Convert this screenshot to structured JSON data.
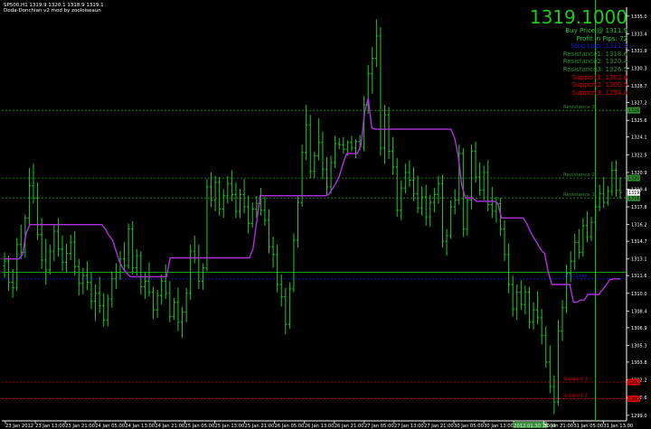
{
  "header": {
    "symbol_line": "SP500,H1  1319.9 1320.1 1318.9 1319.1",
    "indicator_name": "Doda-Donchian v2 mod by zooloiseaun"
  },
  "info_panel": {
    "price": "1319.1000",
    "rows": [
      {
        "text": "Buy Price @  1311.9",
        "color": "#2fc82f"
      },
      {
        "text": "Profit in Pips: 72",
        "color": "#2fc82f"
      },
      {
        "text": "Stop Loss: 1311.3",
        "color": "#1a1ad8"
      },
      {
        "text": "Resistance1: 1318.6",
        "color": "#2f8f2f"
      },
      {
        "text": "Resistance2: 1320.4",
        "color": "#2f8f2f"
      },
      {
        "text": "Resistance3: 1326.5",
        "color": "#2f8f2f"
      },
      {
        "text": "Support1: 1302.0",
        "color": "#e00000"
      },
      {
        "text": "Support2: 1300.5",
        "color": "#e00000"
      },
      {
        "text": "Support3: 1294.0",
        "color": "#e00000"
      }
    ]
  },
  "line_labels": {
    "resistance3": "Resistance 3",
    "resistance2": "Resistance 2",
    "resistance1": "Resistance 1",
    "stoploss": "Stop Loss",
    "support1": "Support 1",
    "support2": "Support 2"
  },
  "colors": {
    "background": "#000000",
    "bars": "#22c81e",
    "donchian": "#b030e0",
    "resistance": "#2f8f2f",
    "stop": "#1a1ad8",
    "support": "#e00000",
    "buy": "#22c81e",
    "axis": "#ffffff"
  },
  "chart_data": {
    "type": "ohlc",
    "symbol": "SP500",
    "timeframe": "H1",
    "ylim": [
      1298.5,
      1335.8
    ],
    "y_ticks": [
      1299.0,
      1300.6,
      1302.2,
      1303.8,
      1305.3,
      1306.9,
      1308.4,
      1310.0,
      1311.6,
      1313.1,
      1314.7,
      1316.2,
      1317.8,
      1319.4,
      1320.9,
      1322.5,
      1324.1,
      1325.6,
      1327.2,
      1328.7,
      1330.3,
      1331.9,
      1333.4,
      1335.0
    ],
    "x_ticks": [
      "23 Jan 2012",
      "23 Jan 13:00",
      "23 Jan 21:00",
      "24 Jan 05:00",
      "24 Jan 13:00",
      "24 Jan 21:00",
      "25 Jan 05:00",
      "25 Jan 13:00",
      "25 Jan 21:00",
      "26 Jan 05:00",
      "26 Jan 13:00",
      "26 Jan 21:00",
      "27 Jan 05:00",
      "27 Jan 13:00",
      "27 Jan 21:00",
      "30 Jan 05:00",
      "30 Jan 13:00",
      "2012.01.30 18:00",
      "30 Jan 21:00",
      "31 Jan 05:00",
      "31 Jan 13:00"
    ],
    "current_time_label": "2012.01.30 18:00",
    "levels": {
      "resistance3": 1326.5,
      "resistance2": 1320.4,
      "resistance1": 1318.6,
      "buy": 1311.9,
      "stop_loss": 1311.3,
      "support1": 1302.0,
      "support2": 1300.5,
      "current_price": 1319.1
    },
    "level_tags": {
      "resistance3": "1326.5",
      "resistance2": "1320.4",
      "resistance1": "1318.6",
      "support1": "1302.0",
      "support2": "1300.5",
      "current_price": "1319.1"
    },
    "ohlc": [
      [
        1312.5,
        1313.7,
        1311.4,
        1312.9
      ],
      [
        1312.9,
        1313.4,
        1310.2,
        1311.0
      ],
      [
        1311.0,
        1312.2,
        1309.6,
        1310.5
      ],
      [
        1310.5,
        1315.0,
        1310.2,
        1314.4
      ],
      [
        1314.4,
        1316.2,
        1313.1,
        1313.7
      ],
      [
        1313.7,
        1317.1,
        1313.2,
        1316.8
      ],
      [
        1316.8,
        1321.3,
        1316.0,
        1319.7
      ],
      [
        1319.7,
        1321.7,
        1318.1,
        1318.6
      ],
      [
        1318.6,
        1320.0,
        1314.8,
        1315.3
      ],
      [
        1315.3,
        1316.8,
        1312.2,
        1313.0
      ],
      [
        1313.0,
        1314.9,
        1310.8,
        1312.1
      ],
      [
        1312.1,
        1314.4,
        1311.7,
        1313.8
      ],
      [
        1313.8,
        1316.2,
        1312.9,
        1315.6
      ],
      [
        1315.6,
        1316.8,
        1313.3,
        1314.0
      ],
      [
        1314.0,
        1315.2,
        1312.0,
        1312.8
      ],
      [
        1312.8,
        1314.5,
        1311.9,
        1313.6
      ],
      [
        1313.6,
        1315.3,
        1313.0,
        1314.6
      ],
      [
        1314.6,
        1315.6,
        1311.6,
        1312.4
      ],
      [
        1312.4,
        1313.1,
        1309.8,
        1310.9
      ],
      [
        1310.9,
        1312.3,
        1309.9,
        1311.6
      ],
      [
        1311.6,
        1312.9,
        1310.3,
        1311.0
      ],
      [
        1311.0,
        1311.9,
        1308.6,
        1309.3
      ],
      [
        1309.3,
        1310.8,
        1307.5,
        1310.0
      ],
      [
        1310.0,
        1311.5,
        1308.2,
        1308.9
      ],
      [
        1308.9,
        1310.0,
        1307.0,
        1307.6
      ],
      [
        1307.6,
        1309.9,
        1307.0,
        1309.5
      ],
      [
        1309.5,
        1312.0,
        1308.7,
        1311.3
      ],
      [
        1311.3,
        1312.7,
        1310.4,
        1311.9
      ],
      [
        1311.9,
        1313.8,
        1311.2,
        1313.1
      ],
      [
        1313.1,
        1314.6,
        1312.0,
        1312.5
      ],
      [
        1312.5,
        1316.3,
        1312.2,
        1315.8
      ],
      [
        1315.8,
        1316.5,
        1311.7,
        1312.3
      ],
      [
        1312.3,
        1314.0,
        1311.6,
        1313.4
      ],
      [
        1313.4,
        1313.8,
        1309.9,
        1310.6
      ],
      [
        1310.6,
        1311.9,
        1309.5,
        1311.1
      ],
      [
        1311.1,
        1312.8,
        1309.7,
        1310.1
      ],
      [
        1310.1,
        1310.6,
        1307.7,
        1308.5
      ],
      [
        1308.5,
        1310.3,
        1307.8,
        1309.8
      ],
      [
        1309.8,
        1311.7,
        1309.0,
        1311.1
      ],
      [
        1311.1,
        1312.6,
        1309.5,
        1310.0
      ],
      [
        1310.0,
        1311.1,
        1307.4,
        1307.9
      ],
      [
        1307.9,
        1309.6,
        1307.6,
        1309.2
      ],
      [
        1309.2,
        1310.5,
        1306.6,
        1307.4
      ],
      [
        1307.4,
        1308.8,
        1306.0,
        1308.3
      ],
      [
        1308.3,
        1310.5,
        1307.4,
        1310.0
      ],
      [
        1310.0,
        1314.4,
        1309.4,
        1313.8
      ],
      [
        1313.8,
        1315.2,
        1312.7,
        1313.2
      ],
      [
        1313.2,
        1314.4,
        1310.4,
        1311.1
      ],
      [
        1311.1,
        1312.7,
        1310.3,
        1312.3
      ],
      [
        1312.3,
        1320.3,
        1312.0,
        1319.6
      ],
      [
        1319.6,
        1320.9,
        1317.8,
        1318.4
      ],
      [
        1318.4,
        1320.6,
        1317.4,
        1320.0
      ],
      [
        1320.0,
        1320.5,
        1317.0,
        1317.6
      ],
      [
        1317.6,
        1319.4,
        1316.8,
        1318.8
      ],
      [
        1318.8,
        1320.6,
        1318.1,
        1319.9
      ],
      [
        1319.9,
        1321.1,
        1318.3,
        1318.9
      ],
      [
        1318.9,
        1320.0,
        1316.8,
        1317.4
      ],
      [
        1317.4,
        1319.4,
        1316.8,
        1318.9
      ],
      [
        1318.9,
        1320.3,
        1317.2,
        1317.8
      ],
      [
        1317.8,
        1318.8,
        1315.4,
        1316.3
      ],
      [
        1316.3,
        1318.2,
        1315.9,
        1317.6
      ],
      [
        1317.6,
        1318.8,
        1316.8,
        1318.1
      ],
      [
        1318.1,
        1319.5,
        1317.0,
        1317.5
      ],
      [
        1317.5,
        1318.7,
        1316.1,
        1316.6
      ],
      [
        1316.6,
        1317.6,
        1313.6,
        1314.2
      ],
      [
        1314.2,
        1315.1,
        1312.3,
        1313.5
      ],
      [
        1313.5,
        1314.4,
        1310.1,
        1310.8
      ],
      [
        1310.8,
        1311.7,
        1308.8,
        1309.7
      ],
      [
        1309.7,
        1310.5,
        1306.3,
        1307.2
      ],
      [
        1307.2,
        1311.0,
        1306.8,
        1310.4
      ],
      [
        1310.4,
        1315.4,
        1310.1,
        1314.8
      ],
      [
        1314.8,
        1318.8,
        1314.1,
        1318.2
      ],
      [
        1318.2,
        1323.4,
        1317.8,
        1322.7
      ],
      [
        1322.7,
        1327.0,
        1322.0,
        1325.2
      ],
      [
        1325.2,
        1326.1,
        1320.4,
        1321.0
      ],
      [
        1321.0,
        1322.8,
        1320.4,
        1322.4
      ],
      [
        1322.4,
        1325.8,
        1322.0,
        1323.6
      ],
      [
        1323.6,
        1324.6,
        1320.3,
        1321.2
      ],
      [
        1321.2,
        1322.3,
        1318.8,
        1319.6
      ],
      [
        1319.6,
        1322.4,
        1319.0,
        1321.8
      ],
      [
        1321.8,
        1324.2,
        1321.3,
        1323.5
      ],
      [
        1323.5,
        1324.0,
        1323.0,
        1323.4
      ],
      [
        1323.4,
        1324.1,
        1322.6,
        1323.0
      ],
      [
        1323.0,
        1323.8,
        1322.4,
        1323.6
      ],
      [
        1323.6,
        1324.2,
        1322.8,
        1323.1
      ],
      [
        1323.1,
        1323.9,
        1322.2,
        1323.7
      ],
      [
        1323.7,
        1324.3,
        1322.9,
        1323.2
      ],
      [
        1323.2,
        1327.8,
        1322.8,
        1327.0
      ],
      [
        1327.0,
        1330.6,
        1326.2,
        1329.8
      ],
      [
        1329.8,
        1332.2,
        1328.0,
        1331.2
      ],
      [
        1331.2,
        1334.7,
        1330.4,
        1333.2
      ],
      [
        1333.2,
        1334.0,
        1322.4,
        1323.1
      ],
      [
        1323.1,
        1327.0,
        1321.7,
        1326.1
      ],
      [
        1326.1,
        1326.8,
        1322.1,
        1322.8
      ],
      [
        1322.8,
        1324.1,
        1320.7,
        1321.4
      ],
      [
        1321.4,
        1322.2,
        1316.9,
        1317.5
      ],
      [
        1317.5,
        1320.2,
        1316.6,
        1319.5
      ],
      [
        1319.5,
        1321.7,
        1319.0,
        1320.9
      ],
      [
        1320.9,
        1322.0,
        1319.6,
        1320.2
      ],
      [
        1320.2,
        1321.4,
        1318.3,
        1319.0
      ],
      [
        1319.0,
        1320.6,
        1317.2,
        1317.7
      ],
      [
        1317.7,
        1319.6,
        1317.0,
        1318.7
      ],
      [
        1318.7,
        1319.8,
        1316.1,
        1316.9
      ],
      [
        1316.9,
        1318.9,
        1316.0,
        1318.2
      ],
      [
        1318.2,
        1319.5,
        1317.3,
        1318.9
      ],
      [
        1318.9,
        1320.6,
        1318.1,
        1319.9
      ],
      [
        1319.9,
        1320.7,
        1314.1,
        1314.7
      ],
      [
        1314.7,
        1315.8,
        1313.4,
        1315.2
      ],
      [
        1315.2,
        1318.4,
        1314.9,
        1317.8
      ],
      [
        1317.8,
        1319.4,
        1317.1,
        1318.4
      ],
      [
        1318.4,
        1323.4,
        1318.0,
        1322.6
      ],
      [
        1322.6,
        1323.1,
        1315.1,
        1315.8
      ],
      [
        1315.8,
        1318.9,
        1315.2,
        1318.4
      ],
      [
        1318.4,
        1323.4,
        1317.6,
        1322.8
      ],
      [
        1322.8,
        1323.7,
        1320.0,
        1320.5
      ],
      [
        1320.5,
        1321.8,
        1318.8,
        1319.3
      ],
      [
        1319.3,
        1321.5,
        1318.4,
        1320.9
      ],
      [
        1320.9,
        1322.0,
        1317.4,
        1318.0
      ],
      [
        1318.0,
        1319.6,
        1316.8,
        1317.4
      ],
      [
        1317.4,
        1318.7,
        1316.4,
        1318.1
      ],
      [
        1318.1,
        1318.6,
        1315.2,
        1315.8
      ],
      [
        1315.8,
        1316.6,
        1312.9,
        1313.5
      ],
      [
        1313.5,
        1314.5,
        1310.0,
        1310.8
      ],
      [
        1310.8,
        1311.6,
        1307.9,
        1308.6
      ],
      [
        1308.6,
        1310.8,
        1307.6,
        1310.1
      ],
      [
        1310.1,
        1311.2,
        1308.5,
        1309.0
      ],
      [
        1309.0,
        1310.7,
        1308.1,
        1310.1
      ],
      [
        1310.1,
        1310.6,
        1306.8,
        1307.4
      ],
      [
        1307.4,
        1309.2,
        1306.7,
        1308.5
      ],
      [
        1308.5,
        1310.2,
        1307.2,
        1307.8
      ],
      [
        1307.8,
        1308.6,
        1305.4,
        1306.2
      ],
      [
        1306.2,
        1307.0,
        1303.3,
        1303.8
      ],
      [
        1303.8,
        1305.3,
        1301.0,
        1301.6
      ],
      [
        1301.6,
        1302.6,
        1299.1,
        1300.2
      ],
      [
        1300.2,
        1307.6,
        1299.9,
        1306.6
      ],
      [
        1306.6,
        1309.4,
        1305.7,
        1308.7
      ],
      [
        1308.7,
        1312.6,
        1308.2,
        1311.8
      ],
      [
        1311.8,
        1313.8,
        1311.0,
        1312.9
      ],
      [
        1312.9,
        1315.4,
        1312.1,
        1314.6
      ],
      [
        1314.6,
        1315.8,
        1313.1,
        1313.7
      ],
      [
        1313.7,
        1316.8,
        1313.3,
        1316.1
      ],
      [
        1316.1,
        1317.4,
        1314.6,
        1315.1
      ],
      [
        1315.1,
        1316.9,
        1314.7,
        1316.4
      ],
      [
        1316.4,
        1318.4,
        1315.9,
        1317.8
      ],
      [
        1317.8,
        1319.8,
        1317.4,
        1319.0
      ],
      [
        1319.0,
        1320.5,
        1317.7,
        1318.2
      ],
      [
        1318.2,
        1319.7,
        1317.9,
        1319.2
      ],
      [
        1319.2,
        1321.9,
        1318.8,
        1321.1
      ],
      [
        1321.1,
        1322.0,
        1318.7,
        1319.3
      ],
      [
        1319.3,
        1320.5,
        1318.5,
        1319.1
      ]
    ],
    "donchian": [
      1313.1,
      1313.1,
      1313.1,
      1313.1,
      1313.1,
      1313.5,
      1315.4,
      1316.2,
      1316.2,
      1316.2,
      1316.2,
      1316.2,
      1316.2,
      1316.2,
      1316.2,
      1316.2,
      1316.2,
      1316.2,
      1316.2,
      1316.2,
      1316.2,
      1316.2,
      1316.2,
      1316.2,
      1316.2,
      1316.2,
      1316.2,
      1316.2,
      1315.8,
      1315.2,
      1314.8,
      1313.8,
      1312.8,
      1312.2,
      1311.8,
      1311.5,
      1311.5,
      1311.5,
      1311.5,
      1311.5,
      1311.5,
      1311.5,
      1311.5,
      1311.5,
      1311.5,
      1311.5,
      1313.2,
      1313.2,
      1313.2,
      1313.2,
      1313.2,
      1313.2,
      1313.2,
      1313.2,
      1313.2,
      1313.2,
      1313.2,
      1313.2,
      1313.2,
      1313.2,
      1313.2,
      1313.2,
      1313.2,
      1313.2,
      1313.2,
      1313.2,
      1313.2,
      1313.2,
      1313.2,
      1314.0,
      1316.4,
      1318.8,
      1318.8,
      1318.8,
      1318.8,
      1318.8,
      1318.8,
      1318.8,
      1318.8,
      1318.8,
      1318.8,
      1318.8,
      1318.8,
      1318.8,
      1318.8,
      1318.8,
      1318.8,
      1318.8,
      1318.8,
      1318.8,
      1318.9,
      1319.4,
      1319.9,
      1320.6,
      1321.7,
      1322.6,
      1322.6,
      1322.6,
      1322.6,
      1323.4,
      1326.3,
      1327.6,
      1324.9,
      1324.8,
      1324.8,
      1324.8,
      1324.8,
      1324.8,
      1324.8,
      1324.8,
      1324.8,
      1324.8,
      1324.8,
      1324.8,
      1324.8,
      1324.8,
      1324.8,
      1324.8,
      1324.8,
      1324.8,
      1324.8,
      1324.8,
      1324.8,
      1324.8,
      1324.8,
      1324.0,
      1322.4,
      1319.7,
      1318.6,
      1318.6,
      1318.6,
      1318.3,
      1318.3,
      1318.3,
      1318.3,
      1318.3,
      1318.3,
      1318.1,
      1316.8,
      1316.8,
      1316.8,
      1316.8,
      1316.8,
      1316.8,
      1316.8,
      1316.3,
      1315.6,
      1315.0,
      1314.5,
      1313.9,
      1313.6,
      1311.9,
      1310.8,
      1310.8,
      1310.8,
      1310.8,
      1310.8,
      1310.8,
      1309.2,
      1309.2,
      1309.4,
      1309.4,
      1309.9,
      1309.9,
      1309.9,
      1309.9,
      1310.3,
      1310.7,
      1311.2,
      1311.3,
      1311.3,
      1311.3
    ]
  }
}
